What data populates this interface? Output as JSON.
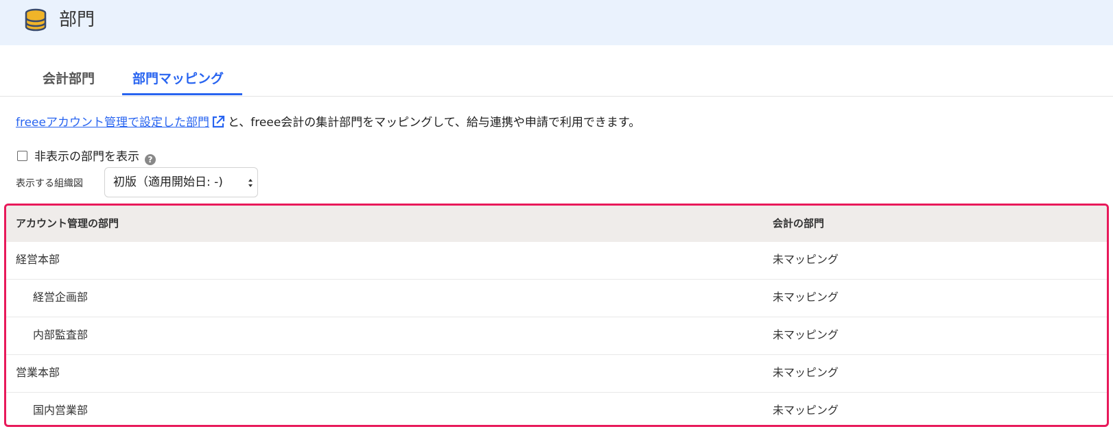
{
  "header": {
    "title": "部門",
    "icon": "database-icon",
    "icon_color": "#f0b429"
  },
  "tabs": [
    {
      "label": "会計部門",
      "active": false
    },
    {
      "label": "部門マッピング",
      "active": true
    }
  ],
  "description": {
    "link_text": "freeeアカウント管理で設定した部門",
    "link_icon": "external-link-icon",
    "rest": "と、freee会計の集計部門をマッピングして、給与連携や申請で利用できます。"
  },
  "show_hidden": {
    "label": "非表示の部門を表示",
    "checked": false,
    "help_icon": "help-icon"
  },
  "org_chart": {
    "label": "表示する組織図",
    "selected": "初版（適用開始日: -)"
  },
  "table": {
    "headers": [
      "アカウント管理の部門",
      "会計の部門"
    ],
    "rows": [
      {
        "name": "経営本部",
        "level": 0,
        "mapping": "未マッピング"
      },
      {
        "name": "経営企画部",
        "level": 1,
        "mapping": "未マッピング"
      },
      {
        "name": "内部監査部",
        "level": 1,
        "mapping": "未マッピング"
      },
      {
        "name": "営業本部",
        "level": 0,
        "mapping": "未マッピング"
      },
      {
        "name": "国内営業部",
        "level": 1,
        "mapping": "未マッピング"
      }
    ]
  },
  "colors": {
    "accent": "#2864f0",
    "highlight_border": "#e8195a",
    "header_bg": "#eaf2fd"
  }
}
